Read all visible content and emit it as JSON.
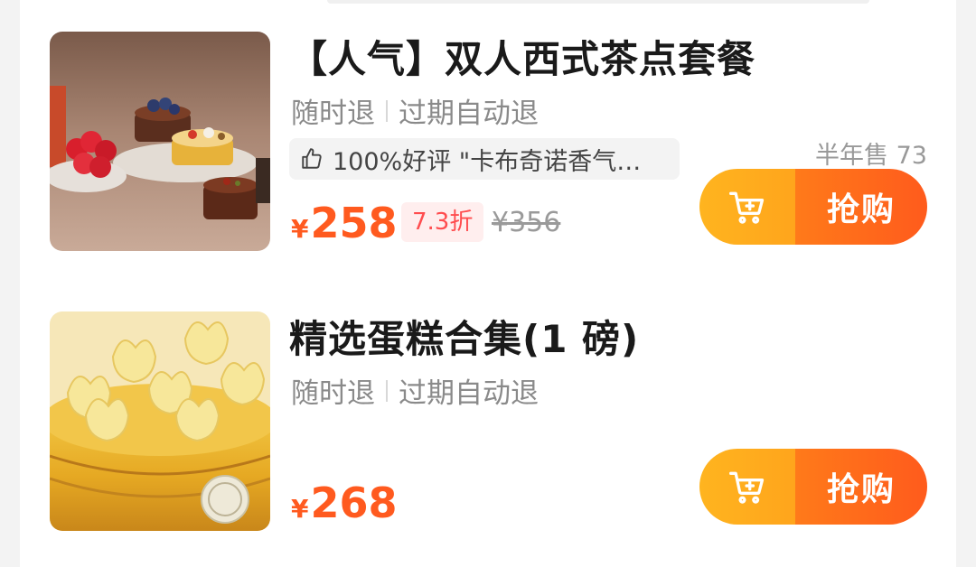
{
  "items": [
    {
      "title": "【人气】双人西式茶点套餐",
      "refund_anytime": "随时退",
      "refund_expired": "过期自动退",
      "review": "100%好评 \"卡布奇诺香气…",
      "sales": "半年售 73",
      "currency": "¥",
      "price": "258",
      "discount": "7.3折",
      "original_price": "¥356",
      "buy_label": "抢购",
      "image": "western-tea-pastries-photo"
    },
    {
      "title": "精选蛋糕合集(1 磅)",
      "refund_anytime": "随时退",
      "refund_expired": "过期自动退",
      "currency": "¥",
      "price": "268",
      "buy_label": "抢购",
      "image": "golden-cake-photo"
    }
  ],
  "icons": {
    "review": "thumbs-up-icon",
    "cart": "add-to-cart-icon"
  },
  "colors": {
    "price": "#ff5a1f",
    "cart_button": "#ffa51c",
    "buy_button": "#ff5b1c",
    "discount_bg": "#ffeeee"
  }
}
